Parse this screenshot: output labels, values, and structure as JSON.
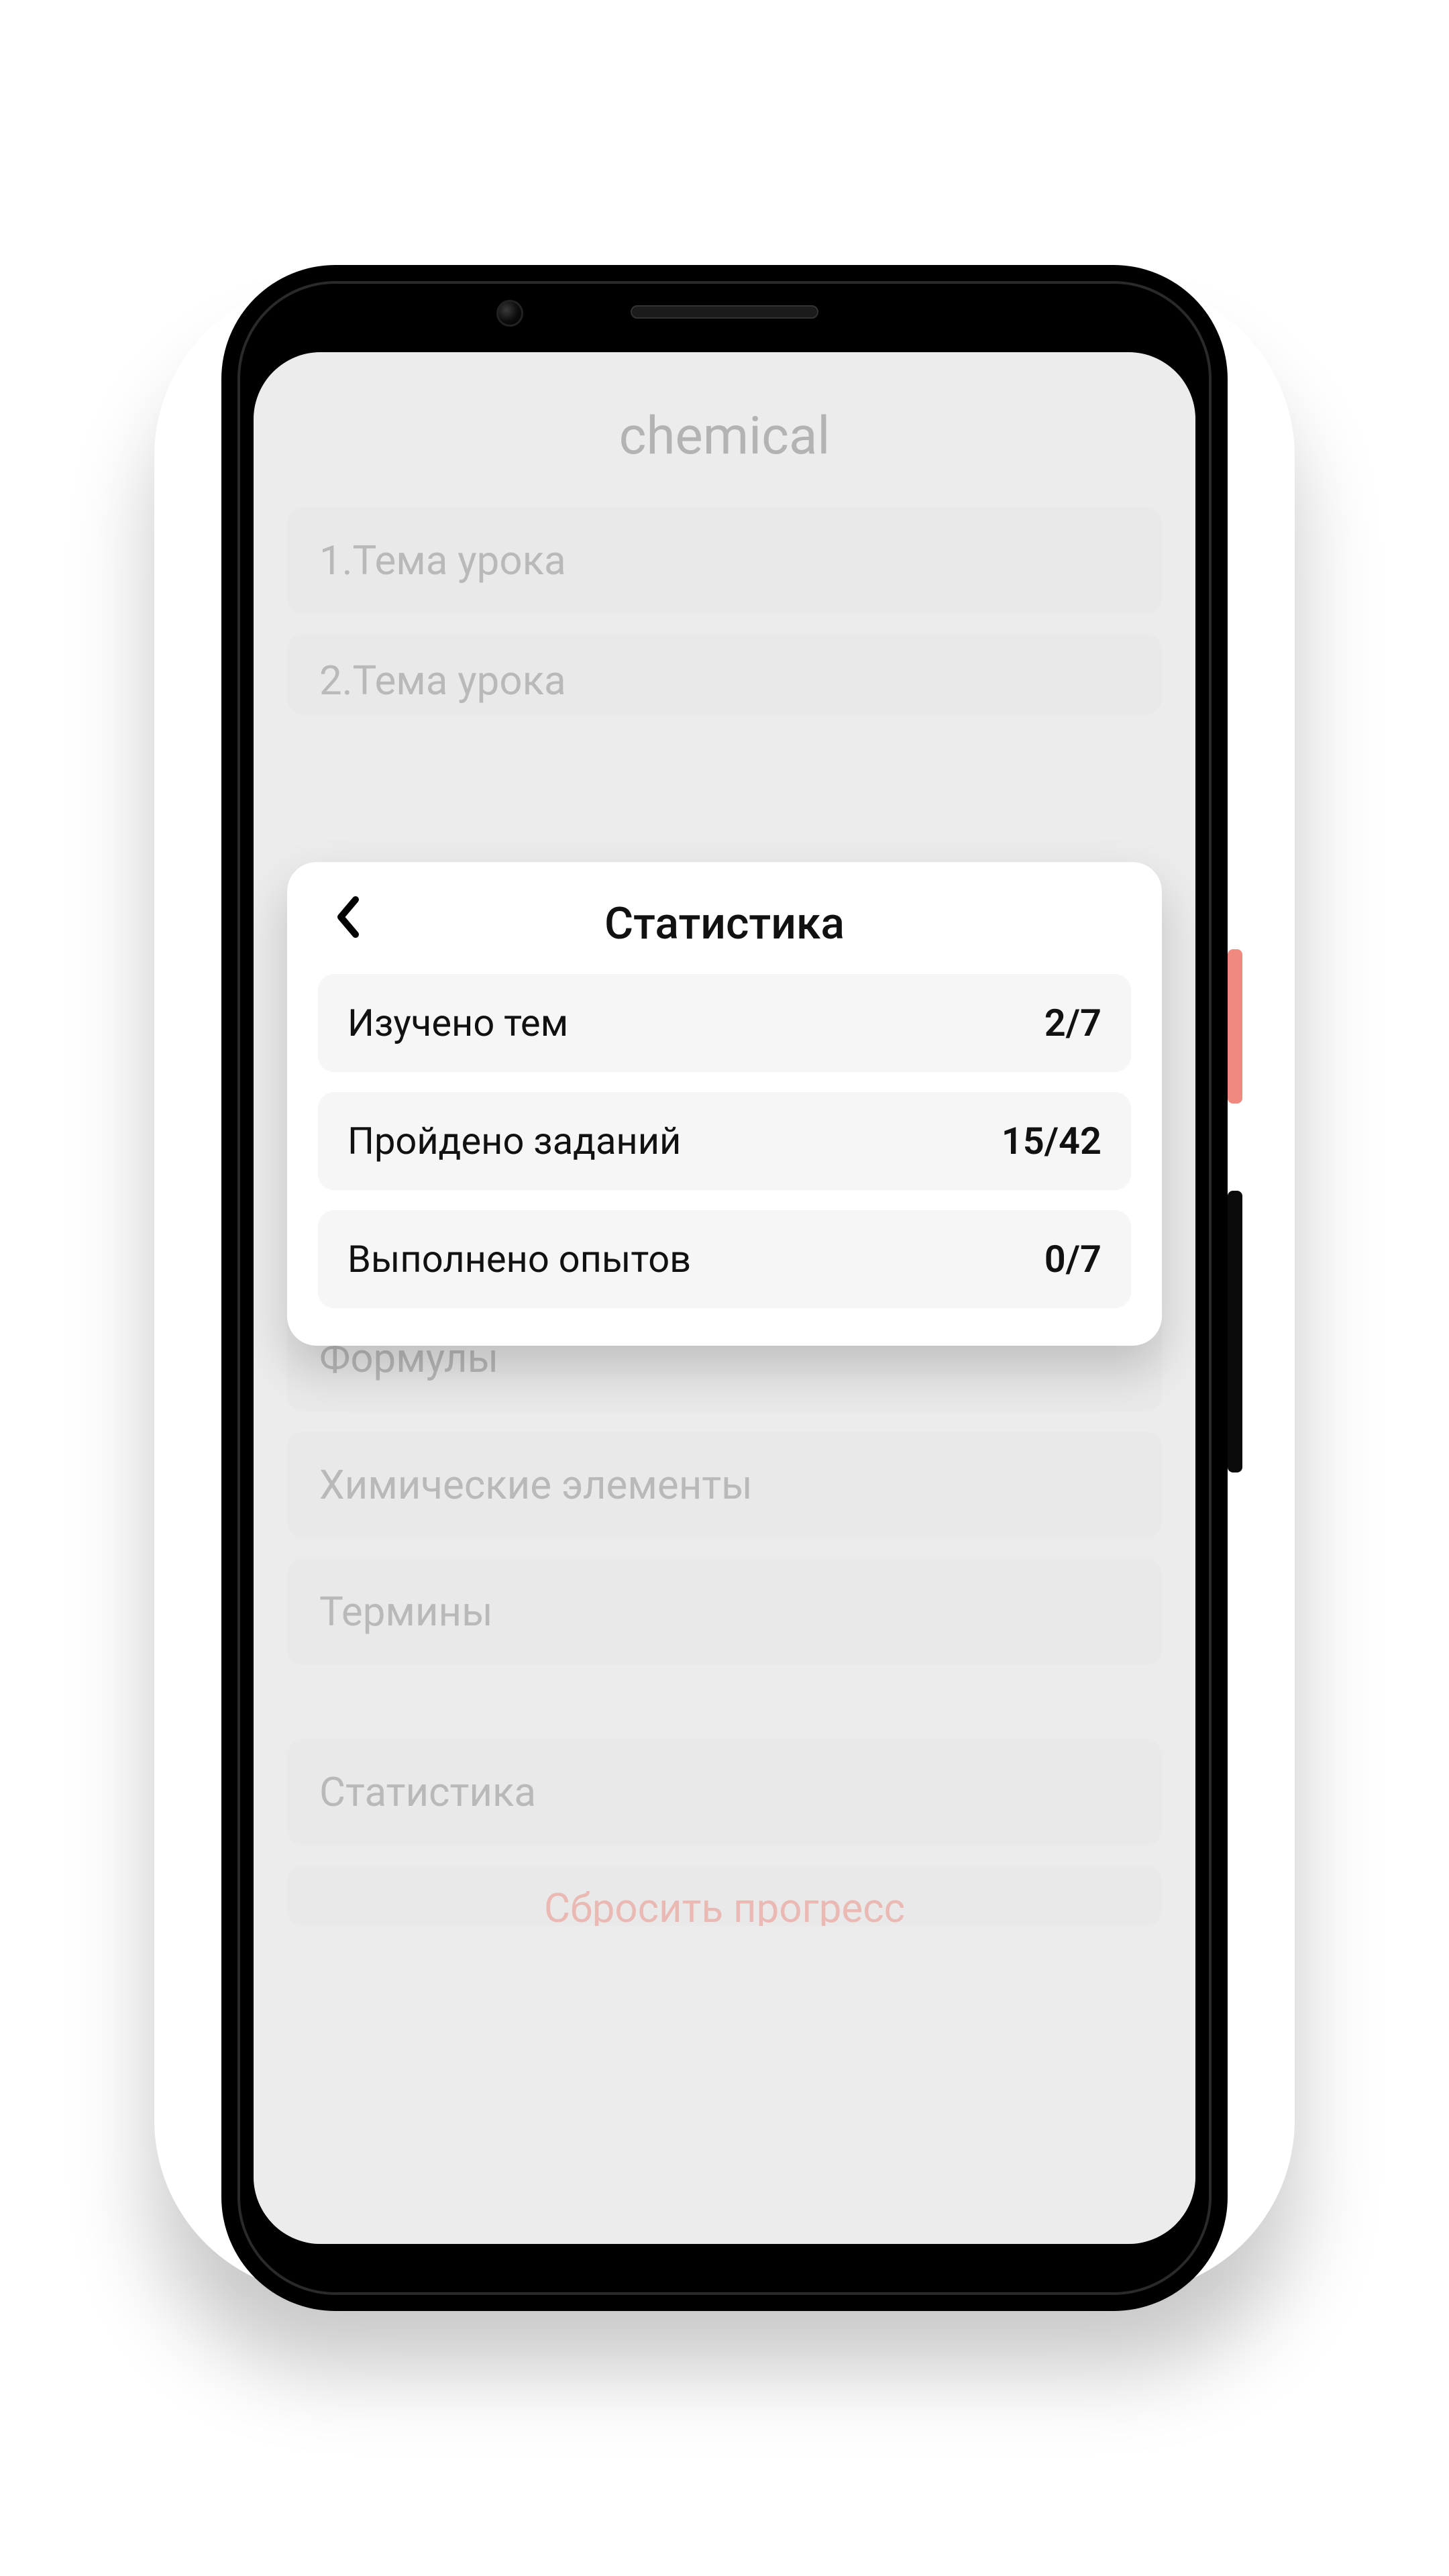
{
  "app": {
    "title": "chemical"
  },
  "lessons": [
    {
      "label": "1.Тема урока"
    },
    {
      "label": "2.Тема урока"
    }
  ],
  "reference": [
    {
      "label": "Формулы"
    },
    {
      "label": "Химические элементы"
    },
    {
      "label": "Термины"
    }
  ],
  "footer": [
    {
      "label": "Статистика"
    },
    {
      "label": "Сбросить прогресс",
      "danger": true
    }
  ],
  "modal": {
    "title": "Статистика",
    "back_icon": "chevron-left",
    "stats": [
      {
        "label": "Изучено тем",
        "value": "2/7"
      },
      {
        "label": "Пройдено заданий",
        "value": "15/42"
      },
      {
        "label": "Выполнено опытов",
        "value": "0/7"
      }
    ]
  },
  "colors": {
    "danger": "#e77a70",
    "card_bg": "#e5e5e5",
    "modal_stat_bg": "#f6f6f6"
  }
}
